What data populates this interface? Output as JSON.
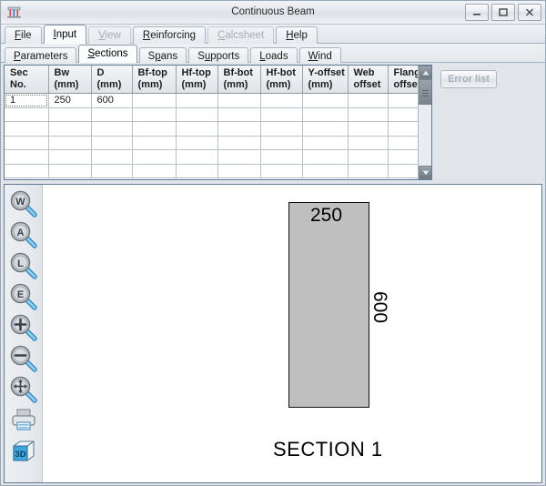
{
  "window": {
    "title": "Continuous Beam",
    "icon": "app-icon",
    "controls": [
      {
        "name": "minimize-button",
        "label": "–"
      },
      {
        "name": "maximize-button",
        "label": "□"
      },
      {
        "name": "close-button",
        "label": "✕"
      }
    ]
  },
  "menu": {
    "items": [
      {
        "label": "File",
        "mnemonic": "F",
        "active": false,
        "disabled": false
      },
      {
        "label": "Input",
        "mnemonic": "I",
        "active": true,
        "disabled": false
      },
      {
        "label": "View",
        "mnemonic": "V",
        "active": false,
        "disabled": true
      },
      {
        "label": "Reinforcing",
        "mnemonic": "R",
        "active": false,
        "disabled": false
      },
      {
        "label": "Calcsheet",
        "mnemonic": "C",
        "active": false,
        "disabled": true
      },
      {
        "label": "Help",
        "mnemonic": "H",
        "active": false,
        "disabled": false
      }
    ]
  },
  "subtabs": {
    "items": [
      {
        "label": "Parameters",
        "mnemonic": "P",
        "active": false
      },
      {
        "label": "Sections",
        "mnemonic": "S",
        "active": true
      },
      {
        "label": "Spans",
        "mnemonic": "p",
        "active": false
      },
      {
        "label": "Supports",
        "mnemonic": "u",
        "active": false
      },
      {
        "label": "Loads",
        "mnemonic": "L",
        "active": false
      },
      {
        "label": "Wind",
        "mnemonic": "W",
        "active": false
      }
    ]
  },
  "table": {
    "columns": [
      {
        "line1": "Sec",
        "line2": "No.",
        "width": 48
      },
      {
        "line1": "Bw",
        "line2": "(mm)",
        "width": 47
      },
      {
        "line1": "D",
        "line2": "(mm)",
        "width": 45
      },
      {
        "line1": "Bf-top",
        "line2": "(mm)",
        "width": 48
      },
      {
        "line1": "Hf-top",
        "line2": "(mm)",
        "width": 46
      },
      {
        "line1": "Bf-bot",
        "line2": "(mm)",
        "width": 47
      },
      {
        "line1": "Hf-bot",
        "line2": "(mm)",
        "width": 46
      },
      {
        "line1": "Y-offset",
        "line2": "(mm)",
        "width": 50
      },
      {
        "line1": "Web",
        "line2": "offset",
        "width": 44
      },
      {
        "line1": "Flange",
        "line2": "offset",
        "width": 45
      }
    ],
    "rows": [
      {
        "cells": [
          "1",
          "250",
          "600",
          "",
          "",
          "",
          "",
          "",
          "",
          ""
        ],
        "states": [
          "focus",
          "sel",
          "sel",
          "",
          "",
          "",
          "",
          "",
          "",
          ""
        ]
      },
      {
        "cells": [
          "",
          "",
          "",
          "",
          "",
          "",
          "",
          "",
          "",
          ""
        ],
        "states": [
          "",
          "",
          "",
          "",
          "",
          "",
          "",
          "",
          "",
          ""
        ]
      },
      {
        "cells": [
          "",
          "",
          "",
          "",
          "",
          "",
          "",
          "",
          "",
          ""
        ],
        "states": [
          "",
          "",
          "",
          "",
          "",
          "",
          "",
          "",
          "",
          ""
        ]
      },
      {
        "cells": [
          "",
          "",
          "",
          "",
          "",
          "",
          "",
          "",
          "",
          ""
        ],
        "states": [
          "",
          "",
          "",
          "",
          "",
          "",
          "",
          "",
          "",
          ""
        ]
      },
      {
        "cells": [
          "",
          "",
          "",
          "",
          "",
          "",
          "",
          "",
          "",
          ""
        ],
        "states": [
          "",
          "",
          "",
          "",
          "",
          "",
          "",
          "",
          "",
          ""
        ]
      },
      {
        "cells": [
          "",
          "",
          "",
          "",
          "",
          "",
          "",
          "",
          "",
          ""
        ],
        "states": [
          "",
          "",
          "",
          "",
          "",
          "",
          "",
          "",
          "",
          ""
        ]
      }
    ],
    "scrollbar": {
      "up": "▲",
      "down": "▼"
    }
  },
  "panel": {
    "error_list_label": "Error list",
    "error_list_enabled": false
  },
  "toolbar": {
    "buttons": [
      {
        "name": "zoom-window-icon",
        "letter": "W",
        "tip": "Zoom Window"
      },
      {
        "name": "zoom-all-icon",
        "letter": "A",
        "tip": "Zoom All"
      },
      {
        "name": "zoom-last-icon",
        "letter": "L",
        "tip": "Zoom Last"
      },
      {
        "name": "zoom-extents-icon",
        "letter": "E",
        "tip": "Zoom Extents"
      },
      {
        "name": "zoom-in-icon",
        "letter": "+",
        "tip": "Zoom In"
      },
      {
        "name": "zoom-out-icon",
        "letter": "−",
        "tip": "Zoom Out"
      },
      {
        "name": "pan-icon",
        "letter": "move",
        "tip": "Pan"
      },
      {
        "name": "print-icon",
        "letter": "print",
        "tip": "Print"
      },
      {
        "name": "view-3d-icon",
        "letter": "3D",
        "tip": "3D View"
      }
    ]
  },
  "drawing": {
    "width_label": "250",
    "depth_label": "600",
    "caption": "SECTION 1",
    "fill_color": "#bfbfbf",
    "stroke_color": "#111111"
  }
}
